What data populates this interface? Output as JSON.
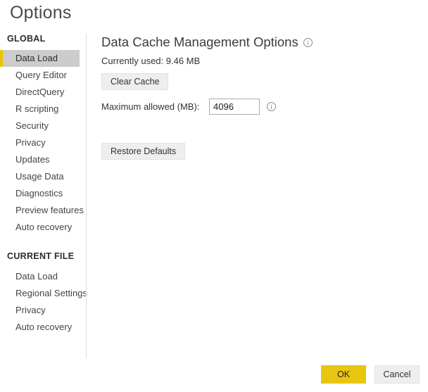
{
  "dialog": {
    "title": "Options"
  },
  "sidebar": {
    "groups": [
      {
        "title": "GLOBAL",
        "items": [
          {
            "label": "Data Load",
            "selected": true
          },
          {
            "label": "Query Editor",
            "selected": false
          },
          {
            "label": "DirectQuery",
            "selected": false
          },
          {
            "label": "R scripting",
            "selected": false
          },
          {
            "label": "Security",
            "selected": false
          },
          {
            "label": "Privacy",
            "selected": false
          },
          {
            "label": "Updates",
            "selected": false
          },
          {
            "label": "Usage Data",
            "selected": false
          },
          {
            "label": "Diagnostics",
            "selected": false
          },
          {
            "label": "Preview features",
            "selected": false
          },
          {
            "label": "Auto recovery",
            "selected": false
          }
        ]
      },
      {
        "title": "CURRENT FILE",
        "items": [
          {
            "label": "Data Load",
            "selected": false
          },
          {
            "label": "Regional Settings",
            "selected": false
          },
          {
            "label": "Privacy",
            "selected": false
          },
          {
            "label": "Auto recovery",
            "selected": false
          }
        ]
      }
    ]
  },
  "main": {
    "heading": "Data Cache Management Options",
    "heading_info_icon": "info-icon",
    "currently_used": "Currently used: 9.46 MB",
    "clear_cache_label": "Clear Cache",
    "max_allowed_label": "Maximum allowed (MB):",
    "max_allowed_value": "4096",
    "max_allowed_placeholder": "4096",
    "max_allowed_info_icon": "info-icon",
    "restore_defaults_label": "Restore Defaults"
  },
  "footer": {
    "ok_label": "OK",
    "cancel_label": "Cancel"
  },
  "colors": {
    "accent_yellow": "#e8c511",
    "selected_row": "#cccccc",
    "button_face": "#eeeeee",
    "divider": "#dedede",
    "text": "#333333"
  }
}
